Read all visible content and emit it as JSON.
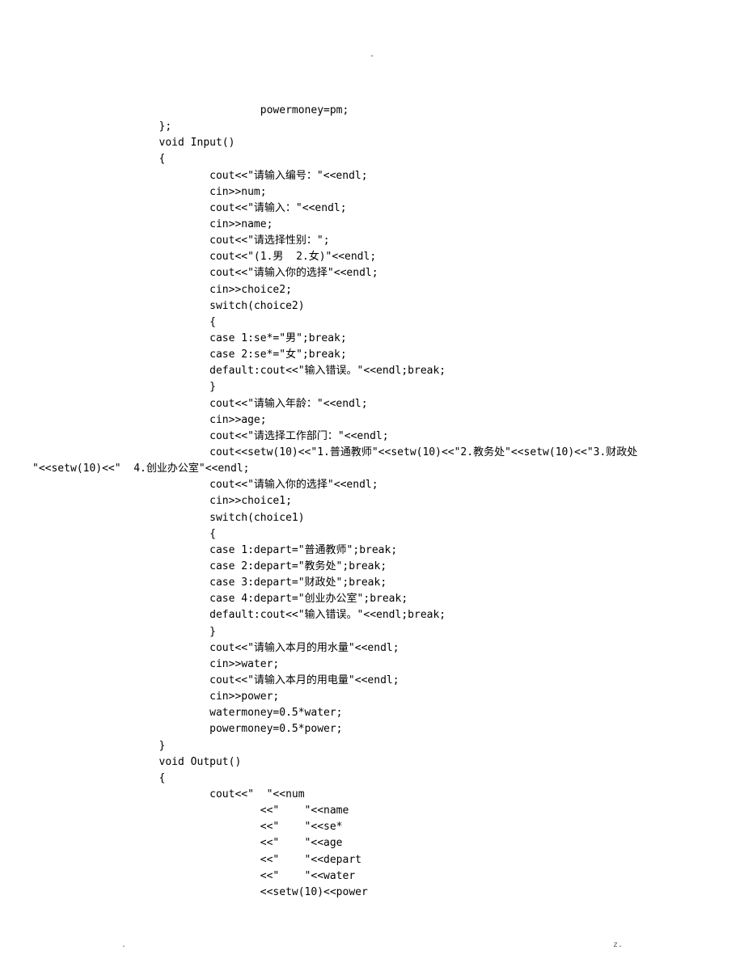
{
  "header_mark": "-",
  "code_lines": [
    "                        powermoney=pm;",
    "        };",
    "        void Input()",
    "        {",
    "                cout<<\"请输入编号：\"<<endl;",
    "                cin>>num;",
    "                cout<<\"请输入：\"<<endl;",
    "                cin>>name;",
    "                cout<<\"请选择性别：\";",
    "                cout<<\"(1.男  2.女)\"<<endl;",
    "                cout<<\"请输入你的选择\"<<endl;",
    "                cin>>choice2;",
    "                switch(choice2)",
    "                {",
    "                case 1:se*=\"男\";break;",
    "                case 2:se*=\"女\";break;",
    "                default:cout<<\"输入错误。\"<<endl;break;",
    "                }",
    "                cout<<\"请输入年龄：\"<<endl;",
    "                cin>>age;",
    "                cout<<\"请选择工作部门：\"<<endl;",
    "                cout<<setw(10)<<\"1.普通教师\"<<setw(10)<<\"2.教务处\"<<setw(10)<<\"3.财政处",
    "\"<<setw(10)<<\"  4.创业办公室\"<<endl;",
    "                cout<<\"请输入你的选择\"<<endl;",
    "                cin>>choice1;",
    "                switch(choice1)",
    "                {",
    "                case 1:depart=\"普通教师\";break;",
    "                case 2:depart=\"教务处\";break;",
    "                case 3:depart=\"财政处\";break;",
    "                case 4:depart=\"创业办公室\";break;",
    "                default:cout<<\"输入错误。\"<<endl;break;",
    "                }",
    "                cout<<\"请输入本月的用水量\"<<endl;",
    "                cin>>water;",
    "                cout<<\"请输入本月的用电量\"<<endl;",
    "                cin>>power;",
    "                watermoney=0.5*water;",
    "                powermoney=0.5*power;",
    "        }",
    "        void Output()",
    "        {",
    "                cout<<\"  \"<<num",
    "                        <<\"    \"<<name",
    "                        <<\"    \"<<se*",
    "                        <<\"    \"<<age",
    "                        <<\"    \"<<depart",
    "                        <<\"    \"<<water",
    "                        <<setw(10)<<power"
  ],
  "footer_left": ".",
  "footer_right": "z."
}
